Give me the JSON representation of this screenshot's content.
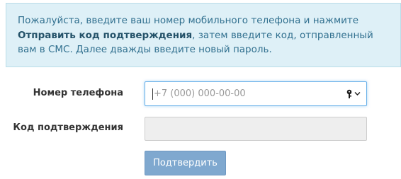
{
  "info": {
    "text_before": "Пожалуйста, введите ваш номер мобильного телефона и нажмите ",
    "bold_text": "Отправить код подтверждения",
    "text_after": ", затем введите код, отправленный вам в СМС. Далее дважды введите новый пароль."
  },
  "form": {
    "phone_label": "Номер телефона",
    "phone_placeholder": "+7 (000) 000-00-00",
    "phone_value": "",
    "code_label": "Код подтверждения",
    "code_value": "",
    "submit_label": "Подтвердить"
  },
  "icons": {
    "password_manager": "key-icon",
    "dropdown": "chevron-down-icon"
  },
  "colors": {
    "info_bg": "#def0f7",
    "info_text": "#31708f",
    "button_bg": "#7fa8cf",
    "focus_border": "#66afe9"
  }
}
